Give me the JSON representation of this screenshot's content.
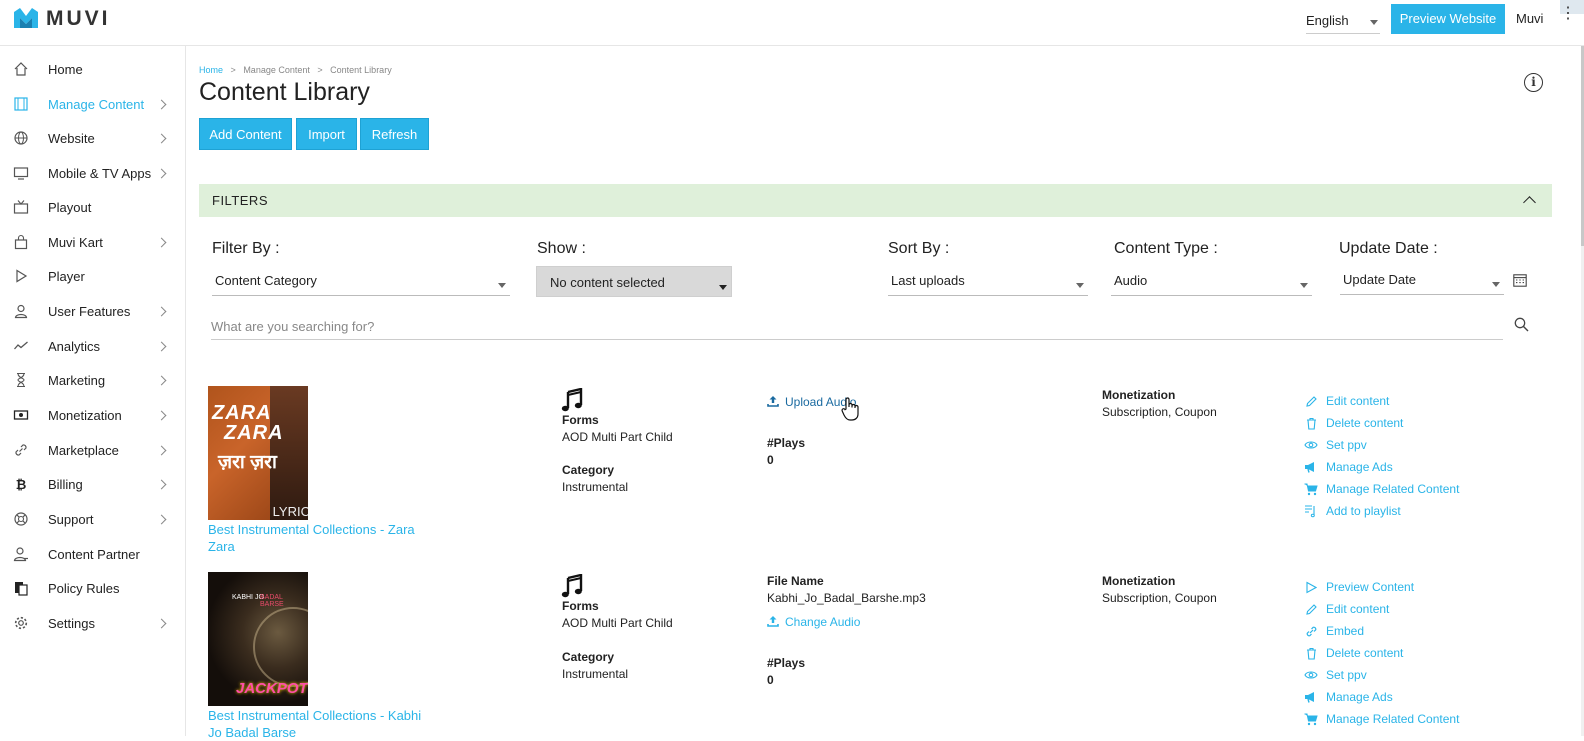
{
  "header": {
    "logo_text": "MUVI",
    "language": "English",
    "preview_label": "Preview Website",
    "user_name": "Muvi"
  },
  "sidebar": {
    "items": [
      {
        "label": "Home",
        "icon": "home-icon",
        "has_chevron": false,
        "active": false
      },
      {
        "label": "Manage Content",
        "icon": "film-icon",
        "has_chevron": true,
        "active": true
      },
      {
        "label": "Website",
        "icon": "globe-icon",
        "has_chevron": true,
        "active": false
      },
      {
        "label": "Mobile & TV Apps",
        "icon": "monitor-icon",
        "has_chevron": true,
        "active": false
      },
      {
        "label": "Playout",
        "icon": "tv-icon",
        "has_chevron": false,
        "active": false
      },
      {
        "label": "Muvi Kart",
        "icon": "shopping-bag-icon",
        "has_chevron": true,
        "active": false
      },
      {
        "label": "Player",
        "icon": "play-icon",
        "has_chevron": false,
        "active": false
      },
      {
        "label": "User Features",
        "icon": "user-icon",
        "has_chevron": true,
        "active": false
      },
      {
        "label": "Analytics",
        "icon": "analytics-icon",
        "has_chevron": true,
        "active": false
      },
      {
        "label": "Marketing",
        "icon": "hourglass-icon",
        "has_chevron": true,
        "active": false
      },
      {
        "label": "Monetization",
        "icon": "money-icon",
        "has_chevron": true,
        "active": false
      },
      {
        "label": "Marketplace",
        "icon": "link-icon",
        "has_chevron": true,
        "active": false
      },
      {
        "label": "Billing",
        "icon": "bitcoin-icon",
        "has_chevron": true,
        "active": false
      },
      {
        "label": "Support",
        "icon": "lifebuoy-icon",
        "has_chevron": true,
        "active": false
      },
      {
        "label": "Content Partner",
        "icon": "partner-icon",
        "has_chevron": false,
        "active": false
      },
      {
        "label": "Policy Rules",
        "icon": "policy-icon",
        "has_chevron": false,
        "active": false
      },
      {
        "label": "Settings",
        "icon": "gear-icon",
        "has_chevron": true,
        "active": false
      }
    ]
  },
  "breadcrumb": {
    "home": "Home",
    "sep": ">",
    "level2": "Manage Content",
    "level3": "Content Library"
  },
  "page_title": "Content Library",
  "buttons": {
    "add": "Add Content",
    "import": "Import",
    "refresh": "Refresh"
  },
  "filters": {
    "header": "FILTERS",
    "filter_by": {
      "label": "Filter By :",
      "value": "Content Category"
    },
    "show": {
      "label": "Show :",
      "value": "No content selected"
    },
    "sort_by": {
      "label": "Sort By :",
      "value": "Last uploads"
    },
    "content_type": {
      "label": "Content Type :",
      "value": "Audio"
    },
    "update_date": {
      "label": "Update Date :",
      "value": "Update Date"
    },
    "search_placeholder": "What are you searching for?"
  },
  "content": [
    {
      "thumb_text": {
        "line1": "ZARA",
        "line2": "ZARA",
        "line3": "ज़रा ज़रा",
        "corner": "LYRIC"
      },
      "title": "Best Instrumental Collections - Zara Zara",
      "forms_label": "Forms",
      "forms_value": "AOD Multi Part Child",
      "category_label": "Category",
      "category_value": "Instrumental",
      "upload_label": "Upload Audio",
      "plays_label": "#Plays",
      "plays_value": "0",
      "monetization_label": "Monetization",
      "monetization_value": "Subscription, Coupon",
      "actions": [
        {
          "label": "Edit content",
          "icon": "pencil-icon"
        },
        {
          "label": "Delete content",
          "icon": "trash-icon"
        },
        {
          "label": "Set ppv",
          "icon": "eye-icon"
        },
        {
          "label": "Manage Ads",
          "icon": "megaphone-icon"
        },
        {
          "label": "Manage Related Content",
          "icon": "cart-icon"
        },
        {
          "label": "Add to playlist",
          "icon": "playlist-icon"
        }
      ]
    },
    {
      "thumb_text": {
        "line1": "KABHI JO",
        "line2": "BADAL BARSE",
        "line3": "JACKPOT"
      },
      "title": "Best Instrumental Collections - Kabhi Jo Badal Barse",
      "forms_label": "Forms",
      "forms_value": "AOD Multi Part Child",
      "category_label": "Category",
      "category_value": "Instrumental",
      "file_name_label": "File Name",
      "file_name_value": "Kabhi_Jo_Badal_Barshe.mp3",
      "change_label": "Change Audio",
      "plays_label": "#Plays",
      "plays_value": "0",
      "monetization_label": "Monetization",
      "monetization_value": "Subscription, Coupon",
      "actions": [
        {
          "label": "Preview Content",
          "icon": "play-outline-icon"
        },
        {
          "label": "Edit content",
          "icon": "pencil-icon"
        },
        {
          "label": "Embed",
          "icon": "link-icon"
        },
        {
          "label": "Delete content",
          "icon": "trash-icon"
        },
        {
          "label": "Set ppv",
          "icon": "eye-icon"
        },
        {
          "label": "Manage Ads",
          "icon": "megaphone-icon"
        },
        {
          "label": "Manage Related Content",
          "icon": "cart-icon"
        }
      ]
    }
  ],
  "colors": {
    "accent": "#2ab4e8",
    "filter_bar": "#dff0da",
    "link_dark": "#1a6aa0"
  }
}
